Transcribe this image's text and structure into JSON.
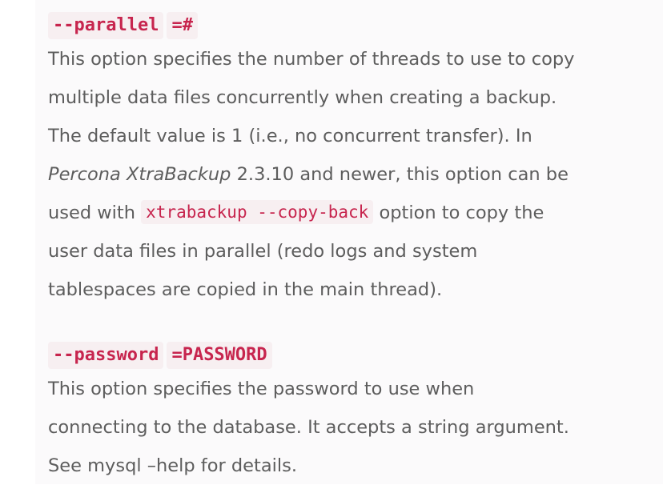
{
  "options": [
    {
      "flag": "--parallel",
      "arg": "=#",
      "desc": {
        "line1": "This option specifies the number of threads to use to copy",
        "line2": "multiple data files concurrently when creating a backup.",
        "line3": "The default value is 1 (i.e., no concurrent transfer). In",
        "line4_em": "Percona XtraBackup",
        "line4_rest": " 2.3.10 and newer, this option can be",
        "line5_pre": "used with ",
        "line5_code": "xtrabackup --copy-back",
        "line5_post": " option to copy the",
        "line6": "user data files in parallel (redo logs and system",
        "line7": "tablespaces are copied in the main thread)."
      }
    },
    {
      "flag": "--password",
      "arg": "=PASSWORD",
      "desc": {
        "line1": "This option specifies the password to use when",
        "line2": "connecting to the database. It accepts a string argument.",
        "line3": "See mysql –help for details."
      }
    }
  ]
}
